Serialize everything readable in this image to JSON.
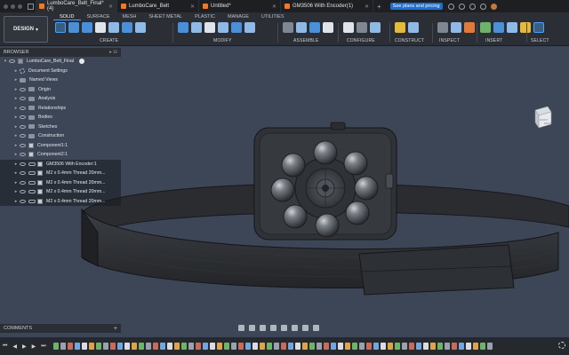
{
  "colors": {
    "accent": "#4aa3ff",
    "plans_button": "#1f6fd1",
    "tab_icon": "#f07a2a",
    "viewport_bg": "#3c4656",
    "panel_bg": "#2b2f35"
  },
  "tabs": [
    {
      "label": "LumboCare_Belt_Final*(4)",
      "active": true
    },
    {
      "label": "LumboCare_Belt",
      "active": false
    },
    {
      "label": "Untitled*",
      "active": false
    },
    {
      "label": "GM3506 With Encoder(1)",
      "active": false
    }
  ],
  "plans_button": "See plans and pricing",
  "toolbar": {
    "workspace": "DESIGN",
    "workspace_tabs": [
      "SOLID",
      "SURFACE",
      "MESH",
      "SHEET METAL",
      "PLASTIC",
      "MANAGE",
      "UTILITIES"
    ],
    "groups": [
      "CREATE",
      "MODIFY",
      "ASSEMBLE",
      "CONFIGURE",
      "CONSTRUCT",
      "INSPECT",
      "INSERT",
      "SELECT"
    ]
  },
  "browser": {
    "title": "BROWSER",
    "root": "LumboCare_Belt_Final",
    "items": [
      "Document Settings",
      "Named Views",
      "Origin",
      "Analysis",
      "Relationships",
      "Bodies",
      "Sketches",
      "Construction",
      "Component1:1",
      "Component2:1",
      "GM3506 With Encoder:1",
      "M2 x 0.4mm Thread 20mm...",
      "M2 x 0.4mm Thread 20mm...",
      "M2 x 0.4mm Thread 20mm...",
      "M2 x 0.4mm Thread 20mm..."
    ]
  },
  "comments": {
    "title": "COMMENTS"
  },
  "viewcube": {
    "labels": [
      "FRONT",
      "RIGHT"
    ]
  },
  "icons": [
    "design-icon",
    "extrude-icon",
    "hole-icon",
    "move-icon",
    "joint-icon",
    "measure-icon",
    "insert-image-icon",
    "select-icon",
    "play-icon",
    "settings-icon"
  ]
}
